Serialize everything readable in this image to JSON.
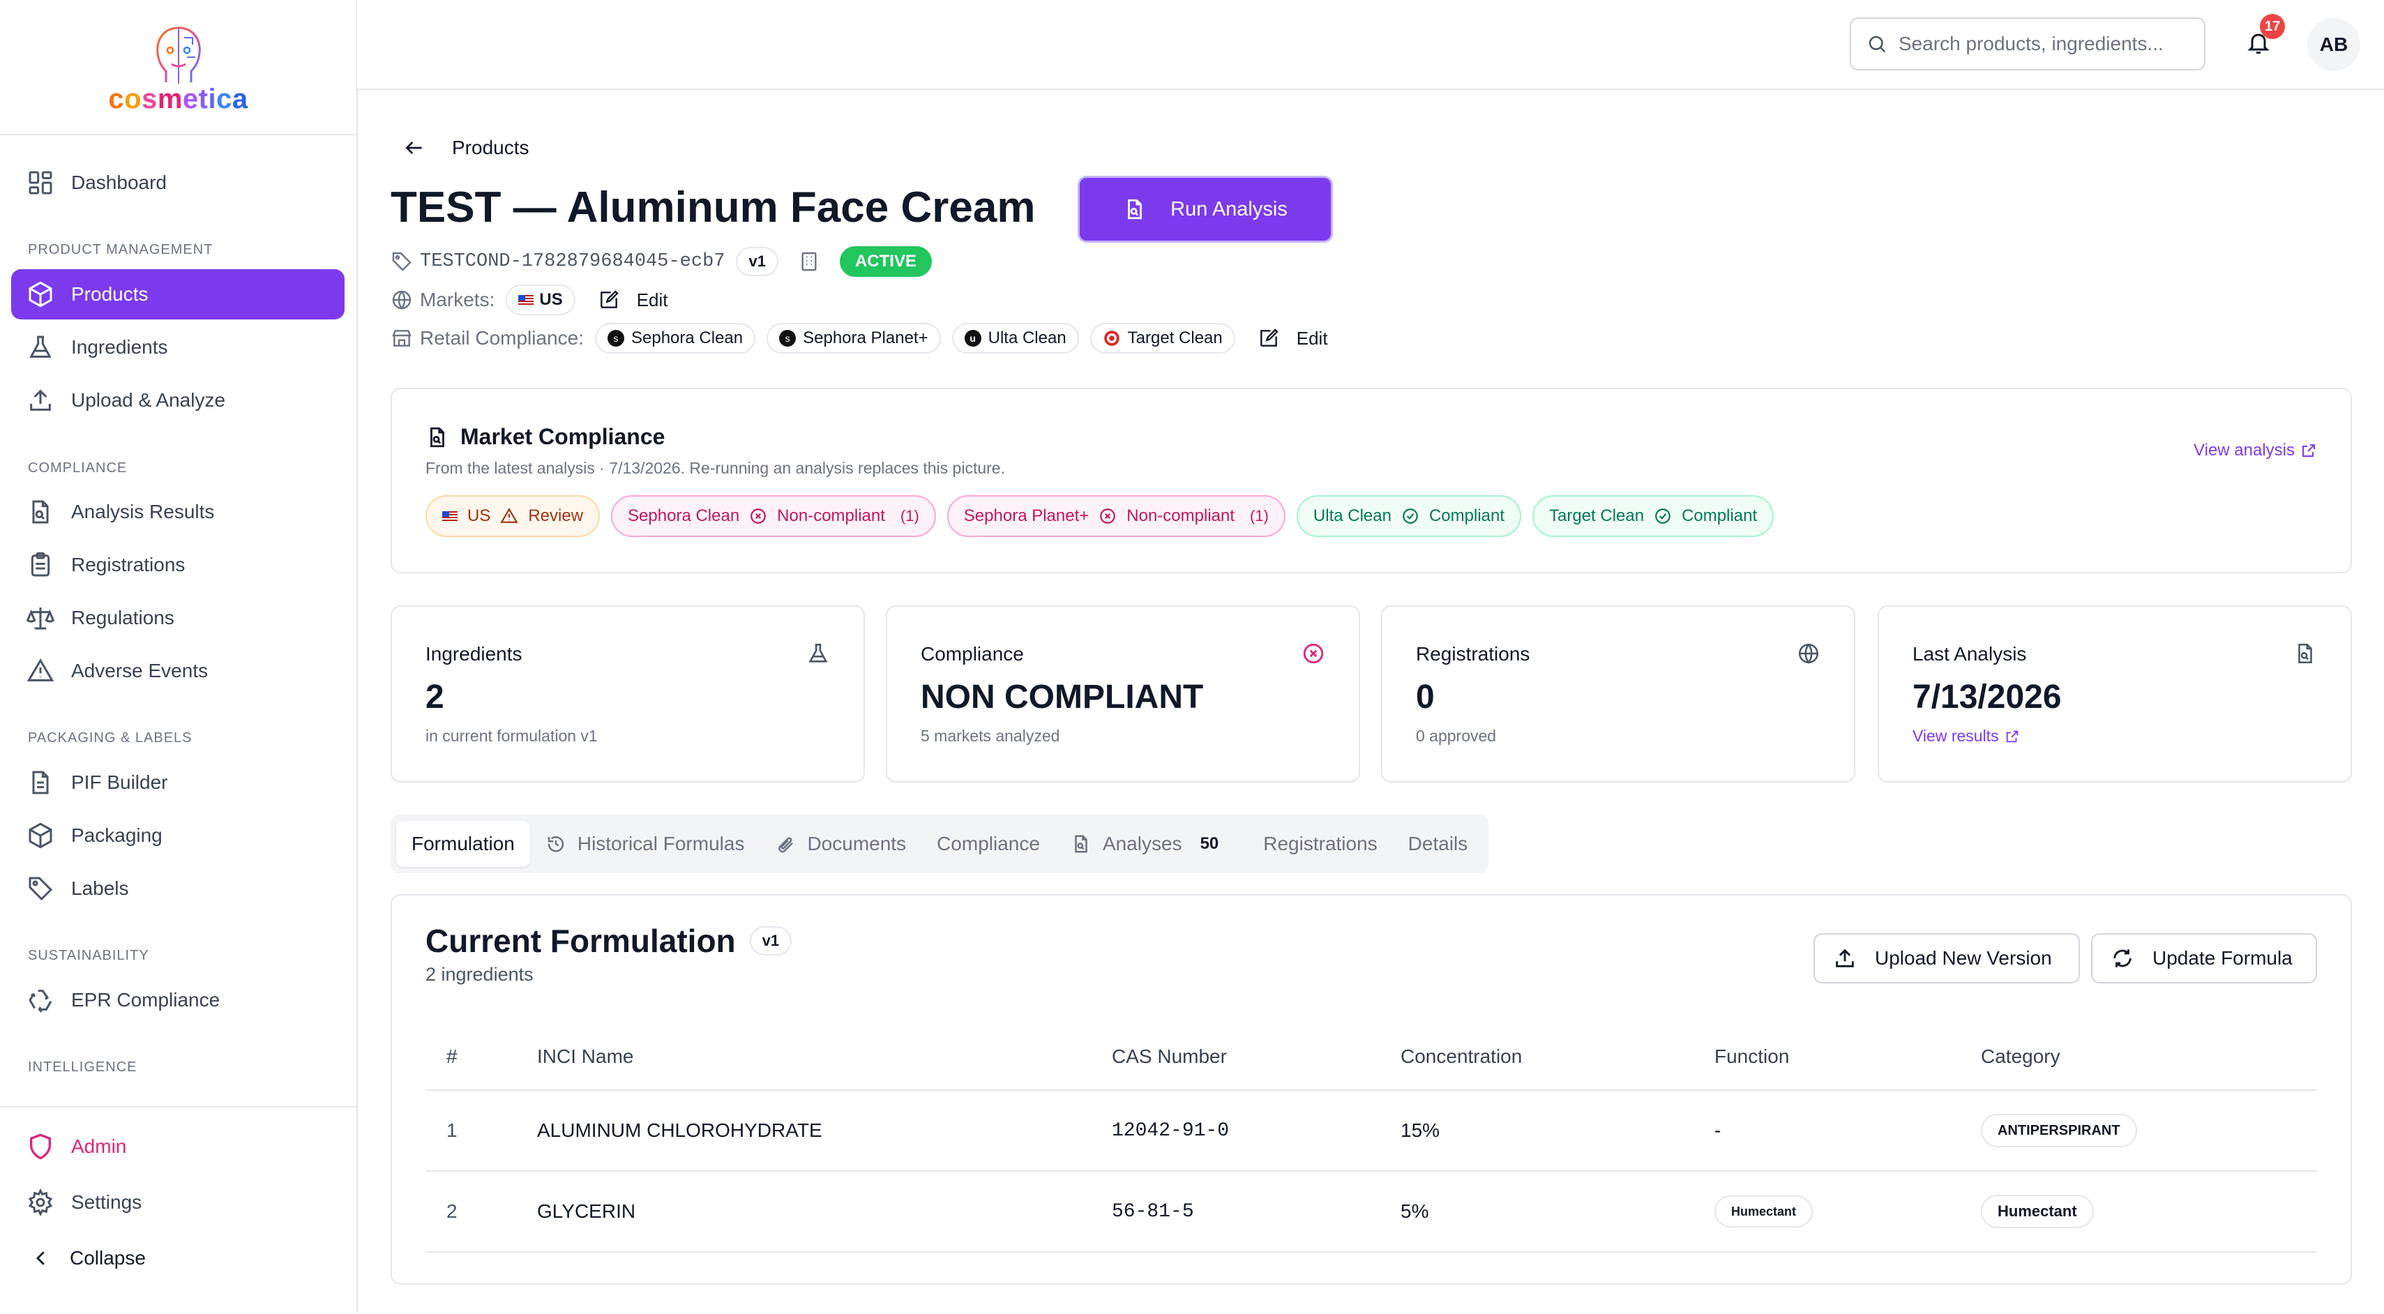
{
  "app": {
    "brand": "cosmetica",
    "brand_colors": [
      "#f97316",
      "#ec4899",
      "#8b5cf6",
      "#3b82f6"
    ]
  },
  "theme": {
    "accent": "#7c3aed",
    "danger": "#db2777",
    "success": "#059669",
    "warning": "#ea580c"
  },
  "sidebar": {
    "dashboard": "Dashboard",
    "sections": {
      "product_management": "PRODUCT MANAGEMENT",
      "compliance": "COMPLIANCE",
      "packaging": "PACKAGING & LABELS",
      "sustainability": "SUSTAINABILITY",
      "intelligence": "INTELLIGENCE"
    },
    "items": {
      "products": "Products",
      "ingredients": "Ingredients",
      "upload": "Upload & Analyze",
      "analysis_results": "Analysis Results",
      "registrations": "Registrations",
      "regulations": "Regulations",
      "adverse_events": "Adverse Events",
      "pif_builder": "PIF Builder",
      "packaging": "Packaging",
      "labels": "Labels",
      "epr": "EPR Compliance"
    },
    "admin": "Admin",
    "settings": "Settings",
    "collapse": "Collapse"
  },
  "header": {
    "search_placeholder": "Search products, ingredients...",
    "notification_count": "17",
    "avatar_initials": "AB"
  },
  "product": {
    "breadcrumb": "Products",
    "title": "TEST — Aluminum Face Cream",
    "sku": "TESTCOND-1782879684045-ecb7",
    "version": "v1",
    "status": "ACTIVE",
    "markets_label": "Markets:",
    "market": "US",
    "edit": "Edit",
    "retail_label": "Retail Compliance:",
    "retailers": [
      "Sephora Clean",
      "Sephora Planet+",
      "Ulta Clean",
      "Target Clean"
    ],
    "run_analysis": "Run Analysis"
  },
  "market_compliance": {
    "title": "Market Compliance",
    "subtitle": "From the latest analysis · 7/13/2026. Re-running an analysis replaces this picture.",
    "view_analysis": "View analysis",
    "statuses": [
      {
        "name": "US",
        "status": "Review",
        "count": ""
      },
      {
        "name": "Sephora Clean",
        "status": "Non-compliant",
        "count": "(1)"
      },
      {
        "name": "Sephora Planet+",
        "status": "Non-compliant",
        "count": "(1)"
      },
      {
        "name": "Ulta Clean",
        "status": "Compliant",
        "count": ""
      },
      {
        "name": "Target Clean",
        "status": "Compliant",
        "count": ""
      }
    ]
  },
  "stats": {
    "ingredients": {
      "label": "Ingredients",
      "value": "2",
      "sub": "in current formulation v1"
    },
    "compliance": {
      "label": "Compliance",
      "value": "NON COMPLIANT",
      "sub": "5 markets analyzed"
    },
    "registrations": {
      "label": "Registrations",
      "value": "0",
      "sub": "0 approved"
    },
    "last_analysis": {
      "label": "Last Analysis",
      "value": "7/13/2026",
      "sub": "View results"
    }
  },
  "tabs": {
    "formulation": "Formulation",
    "historical": "Historical Formulas",
    "documents": "Documents",
    "compliance": "Compliance",
    "analyses": "Analyses",
    "analyses_count": "50",
    "registrations": "Registrations",
    "details": "Details"
  },
  "formulation": {
    "title": "Current Formulation",
    "version": "v1",
    "count": "2 ingredients",
    "upload_button": "Upload New Version",
    "update_button": "Update Formula",
    "columns": [
      "#",
      "INCI Name",
      "CAS Number",
      "Concentration",
      "Function",
      "Category"
    ],
    "rows": [
      {
        "n": "1",
        "inci": "ALUMINUM CHLOROHYDRATE",
        "cas": "12042-91-0",
        "conc": "15%",
        "function": "-",
        "category": "ANTIPERSPIRANT"
      },
      {
        "n": "2",
        "inci": "GLYCERIN",
        "cas": "56-81-5",
        "conc": "5%",
        "function": "Humectant",
        "category": "Humectant"
      }
    ]
  }
}
